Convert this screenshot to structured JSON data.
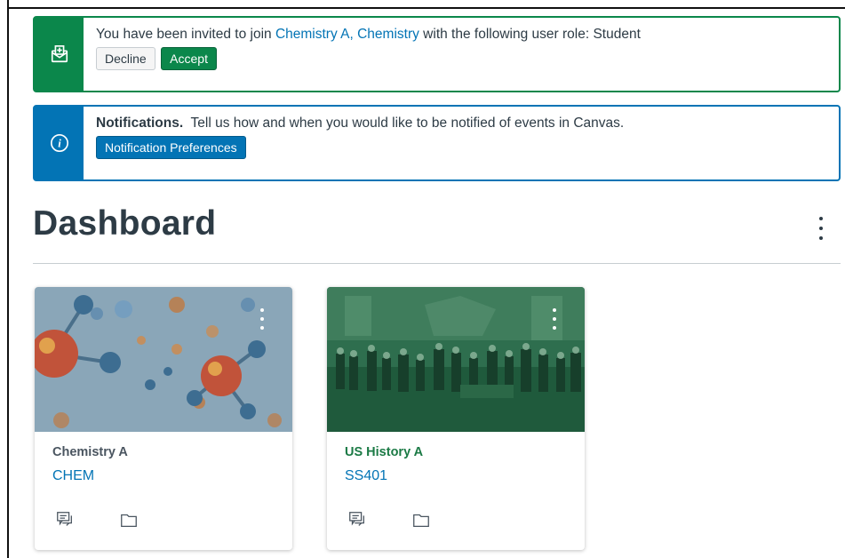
{
  "colors": {
    "success": "#0b874b",
    "info": "#0374b5",
    "text": "#2d3b45",
    "chem_title": "#4a5560",
    "history_title": "#1b7a45"
  },
  "invite": {
    "prefix": "You have been invited to join ",
    "course_link": "Chemistry A, Chemistry",
    "suffix": " with the following user role: Student",
    "decline_label": "Decline",
    "accept_label": "Accept",
    "icon": "envelope-add-icon"
  },
  "notification": {
    "heading": "Notifications.",
    "text": "Tell us how and when you would like to be notified of events in Canvas.",
    "button_label": "Notification Preferences",
    "icon": "info-icon"
  },
  "dashboard": {
    "title": "Dashboard",
    "menu_icon": "kebab-menu-icon"
  },
  "courses": [
    {
      "title": "Chemistry A",
      "code": "CHEM",
      "image": "molecules",
      "actions": [
        "discussions-icon",
        "files-icon"
      ]
    },
    {
      "title": "US History A",
      "code": "SS401",
      "image": "declaration-painting",
      "actions": [
        "discussions-icon",
        "files-icon"
      ]
    }
  ]
}
